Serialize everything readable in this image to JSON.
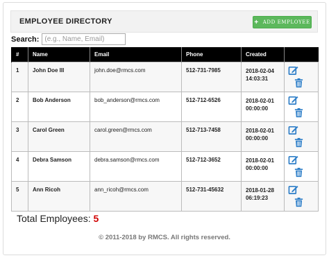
{
  "header": {
    "title": "EMPLOYEE DIRECTORY",
    "add_button_label": "ADD EMPLOYEE",
    "add_button_icon": "plus-icon"
  },
  "search": {
    "label": "Search:",
    "placeholder": "(e.g., Name, Email)",
    "value": ""
  },
  "table": {
    "columns": [
      "#",
      "Name",
      "Email",
      "Phone",
      "Created",
      ""
    ],
    "rows": [
      {
        "id": "1",
        "name": "John Doe III",
        "email": "john.doe@rmcs.com",
        "phone": "512-731-7985",
        "created_date": "2018-02-04",
        "created_time": "14:03:31"
      },
      {
        "id": "2",
        "name": "Bob Anderson",
        "email": "bob_anderson@rmcs.com",
        "phone": "512-712-6526",
        "created_date": "2018-02-01",
        "created_time": "00:00:00"
      },
      {
        "id": "3",
        "name": "Carol Green",
        "email": "carol.green@rmcs.com",
        "phone": "512-713-7458",
        "created_date": "2018-02-01",
        "created_time": "00:00:00"
      },
      {
        "id": "4",
        "name": "Debra Samson",
        "email": "debra.samson@rmcs.com",
        "phone": "512-712-3652",
        "created_date": "2018-02-01",
        "created_time": "00:00:00"
      },
      {
        "id": "5",
        "name": "Ann Ricoh",
        "email": "ann_ricoh@rmcs.com",
        "phone": "512-731-45632",
        "created_date": "2018-01-28",
        "created_time": "06:19:23"
      }
    ],
    "row_action_icons": [
      "edit-icon",
      "trash-icon"
    ]
  },
  "summary": {
    "total_label": "Total Employees:",
    "total_count": "5"
  },
  "footer": {
    "text": "© 2011-2018 by RMCS. All rights reserved."
  },
  "colors": {
    "header_bg": "#000000",
    "add_button": "#5cb85c",
    "icon_blue": "#2f7fc8",
    "count_red": "#d00000"
  }
}
